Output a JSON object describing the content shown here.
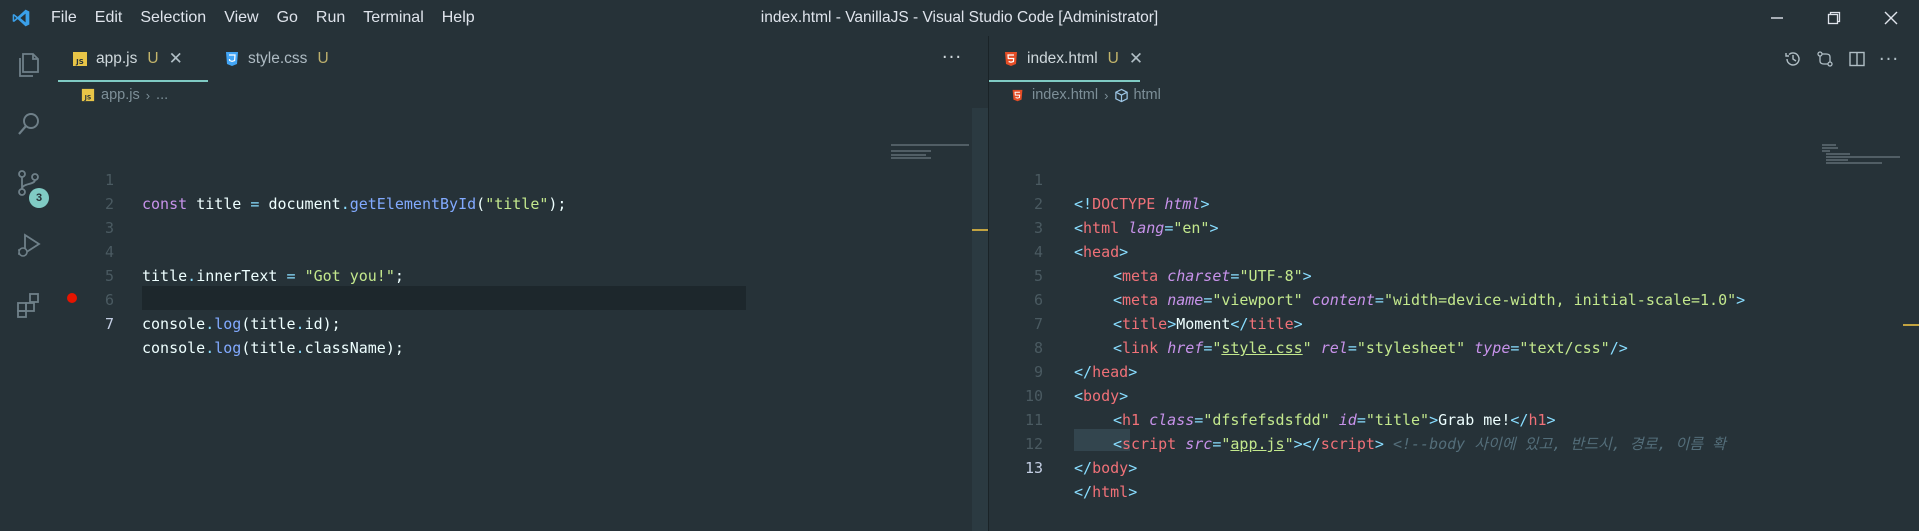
{
  "window": {
    "title": "index.html - VanillaJS - Visual Studio Code [Administrator]"
  },
  "menu": [
    "File",
    "Edit",
    "Selection",
    "View",
    "Go",
    "Run",
    "Terminal",
    "Help"
  ],
  "activity": {
    "items": [
      "explorer-icon",
      "search-icon",
      "source-control-icon",
      "run-debug-icon",
      "extensions-icon"
    ],
    "scm_badge": "3"
  },
  "left_group": {
    "tabs": [
      {
        "label": "app.js",
        "status": "U",
        "icon": "js-file-icon"
      },
      {
        "label": "style.css",
        "status": "U",
        "icon": "css-file-icon"
      }
    ],
    "breadcrumb": {
      "file": "app.js",
      "rest": "..."
    },
    "more": "···",
    "lines": [
      "1",
      "2",
      "3",
      "4",
      "5",
      "6",
      "7"
    ],
    "code": {
      "l1": {
        "kw": "const",
        "name": "title",
        "op": "=",
        "obj": "document",
        "dot": ".",
        "fn": "getElementById",
        "lp": "(",
        "str": "\"title\"",
        "rp": ");"
      },
      "l4": {
        "obj": "title",
        "dot": ".",
        "prop": "innerText",
        "op": "=",
        "str": "\"Got you!\"",
        "end": ";"
      },
      "l6": {
        "obj": "console",
        "dot": ".",
        "fn": "log",
        "lp": "(",
        "arg": "title",
        "dot2": ".",
        "prop": "id",
        "rp": ");"
      },
      "l7": {
        "obj": "console",
        "dot": ".",
        "fn": "log",
        "lp": "(",
        "arg": "title",
        "dot2": ".",
        "prop": "className",
        "rp": ");"
      }
    }
  },
  "right_group": {
    "tab": {
      "label": "index.html",
      "status": "U",
      "icon": "html-file-icon"
    },
    "breadcrumb": {
      "file": "index.html",
      "symbol": "html"
    },
    "lines": [
      "1",
      "2",
      "3",
      "4",
      "5",
      "6",
      "7",
      "8",
      "9",
      "10",
      "11",
      "12",
      "13"
    ],
    "code": {
      "l1": {
        "open": "<!",
        "tag": "DOCTYPE",
        "attr": "html",
        "close": ">"
      },
      "l2": {
        "open": "<",
        "tag": "html",
        "attr": "lang",
        "eq": "=",
        "val": "\"en\"",
        "close": ">"
      },
      "l3": {
        "open": "<",
        "tag": "head",
        "close": ">"
      },
      "l4": {
        "open": "<",
        "tag": "meta",
        "attr": "charset",
        "eq": "=",
        "val": "\"UTF-8\"",
        "close": ">"
      },
      "l5": {
        "open": "<",
        "tag": "meta",
        "attr1": "name",
        "eq1": "=",
        "val1": "\"viewport\"",
        "attr2": "content",
        "eq2": "=",
        "val2": "\"width=device-width, initial-scale=1.0\"",
        "close": ">"
      },
      "l6": {
        "open": "<",
        "tag": "title",
        "close": ">",
        "text": "Moment",
        "open2": "</",
        "tag2": "title",
        "close2": ">"
      },
      "l7": {
        "open": "<",
        "tag": "link",
        "attr1": "href",
        "eq1": "=",
        "q1": "\"",
        "val1": "style.css",
        "q1b": "\"",
        "attr2": "rel",
        "eq2": "=",
        "val2": "\"stylesheet\"",
        "attr3": "type",
        "eq3": "=",
        "val3": "\"text/css\"",
        "close": "/>"
      },
      "l8": {
        "open": "</",
        "tag": "head",
        "close": ">"
      },
      "l9": {
        "open": "<",
        "tag": "body",
        "close": ">"
      },
      "l10": {
        "open": "<",
        "tag": "h1",
        "attr1": "class",
        "eq1": "=",
        "val1": "\"dfsfefsdsfdd\"",
        "attr2": "id",
        "eq2": "=",
        "val2": "\"title\"",
        "close": ">",
        "text": "Grab me!",
        "open2": "</",
        "tag2": "h1",
        "close2": ">"
      },
      "l11": {
        "open": "<",
        "tag": "script",
        "attr": "src",
        "eq": "=",
        "q1": "\"",
        "val": "app.js",
        "q1b": "\"",
        "close": ">",
        "open2": "</",
        "tag2": "script",
        "close2": ">",
        "comment": "<!--body 사이에 있고, 반드시, 경로, 이름 확"
      },
      "l12": {
        "open": "</",
        "tag": "body",
        "close": ">"
      },
      "l13": {
        "open": "</",
        "tag": "html",
        "close": ">"
      }
    }
  }
}
